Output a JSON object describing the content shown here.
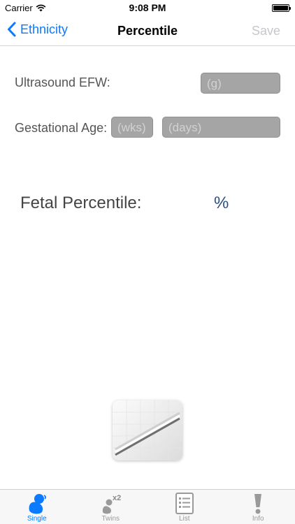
{
  "status_bar": {
    "carrier": "Carrier",
    "time": "9:08 PM"
  },
  "nav": {
    "back_label": "Ethnicity",
    "title": "Percentile",
    "save_label": "Save"
  },
  "form": {
    "efw_label": "Ultrasound EFW:",
    "efw_placeholder": "(g)",
    "ga_label": "Gestational Age:",
    "weeks_placeholder": "(wks)",
    "days_placeholder": "(days)"
  },
  "result": {
    "label": "Fetal Percentile:",
    "unit": "%"
  },
  "tabs": [
    {
      "label": "Single",
      "icon": "fetus-icon",
      "active": true
    },
    {
      "label": "Twins",
      "icon": "twins-icon",
      "badge": "x2"
    },
    {
      "label": "List",
      "icon": "list-icon"
    },
    {
      "label": "Info",
      "icon": "exclamation-icon"
    }
  ],
  "colors": {
    "accent": "#0a7aff",
    "field_bg": "#a5a5a5",
    "percent_color": "#2d4f85"
  }
}
